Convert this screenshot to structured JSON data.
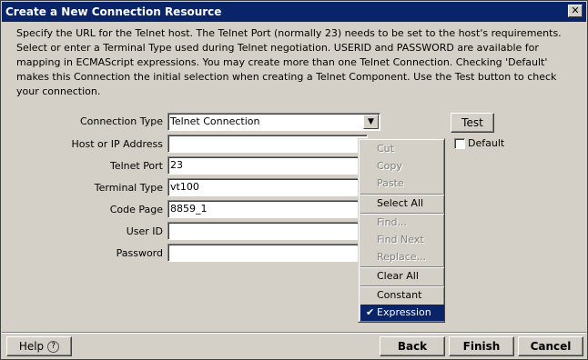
{
  "window": {
    "title": "Create a New Connection Resource",
    "close_glyph": "✕"
  },
  "description": "Specify the URL for the Telnet host.  The Telnet Port (normally 23) needs to be set to the host's requirements.  Select or enter a Terminal Type used during Telnet negotiation.  USERID and PASSWORD are available for mapping in ECMAScript expressions.  You may create more than one Telnet Connection.  Checking 'Default' makes this Connection the initial selection when creating a Telnet Component.  Use the Test button to check your connection.",
  "form": {
    "connection_type": {
      "label": "Connection Type",
      "value": "Telnet Connection"
    },
    "host": {
      "label": "Host or IP Address",
      "value": ""
    },
    "port": {
      "label": "Telnet Port",
      "value": "23"
    },
    "terminal_type": {
      "label": "Terminal Type",
      "value": "vt100"
    },
    "code_page": {
      "label": "Code Page",
      "value": "8859_1"
    },
    "user_id": {
      "label": "User ID",
      "value": ""
    },
    "password": {
      "label": "Password",
      "value": ""
    },
    "test_label": "Test",
    "default_label": "Default",
    "default_checked": false
  },
  "context_menu": {
    "items": [
      {
        "label": "Cut",
        "enabled": false
      },
      {
        "label": "Copy",
        "enabled": false
      },
      {
        "label": "Paste",
        "enabled": false
      },
      {
        "label": "Select All",
        "enabled": true
      },
      {
        "label": "Find...",
        "enabled": false
      },
      {
        "label": "Find Next",
        "enabled": false
      },
      {
        "label": "Replace...",
        "enabled": false
      },
      {
        "label": "Clear All",
        "enabled": true
      },
      {
        "label": "Constant",
        "enabled": true
      },
      {
        "label": "Expression",
        "enabled": true,
        "checked": true,
        "selected": true
      }
    ],
    "check_glyph": "✔"
  },
  "footer": {
    "help_label": "Help",
    "help_icon": "?",
    "back_label": "Back",
    "finish_label": "Finish",
    "cancel_label": "Cancel"
  },
  "colors": {
    "titlebar": "#0a246a",
    "dialog_bg": "#d4d0c8",
    "menu_highlight": "#0a246a"
  }
}
